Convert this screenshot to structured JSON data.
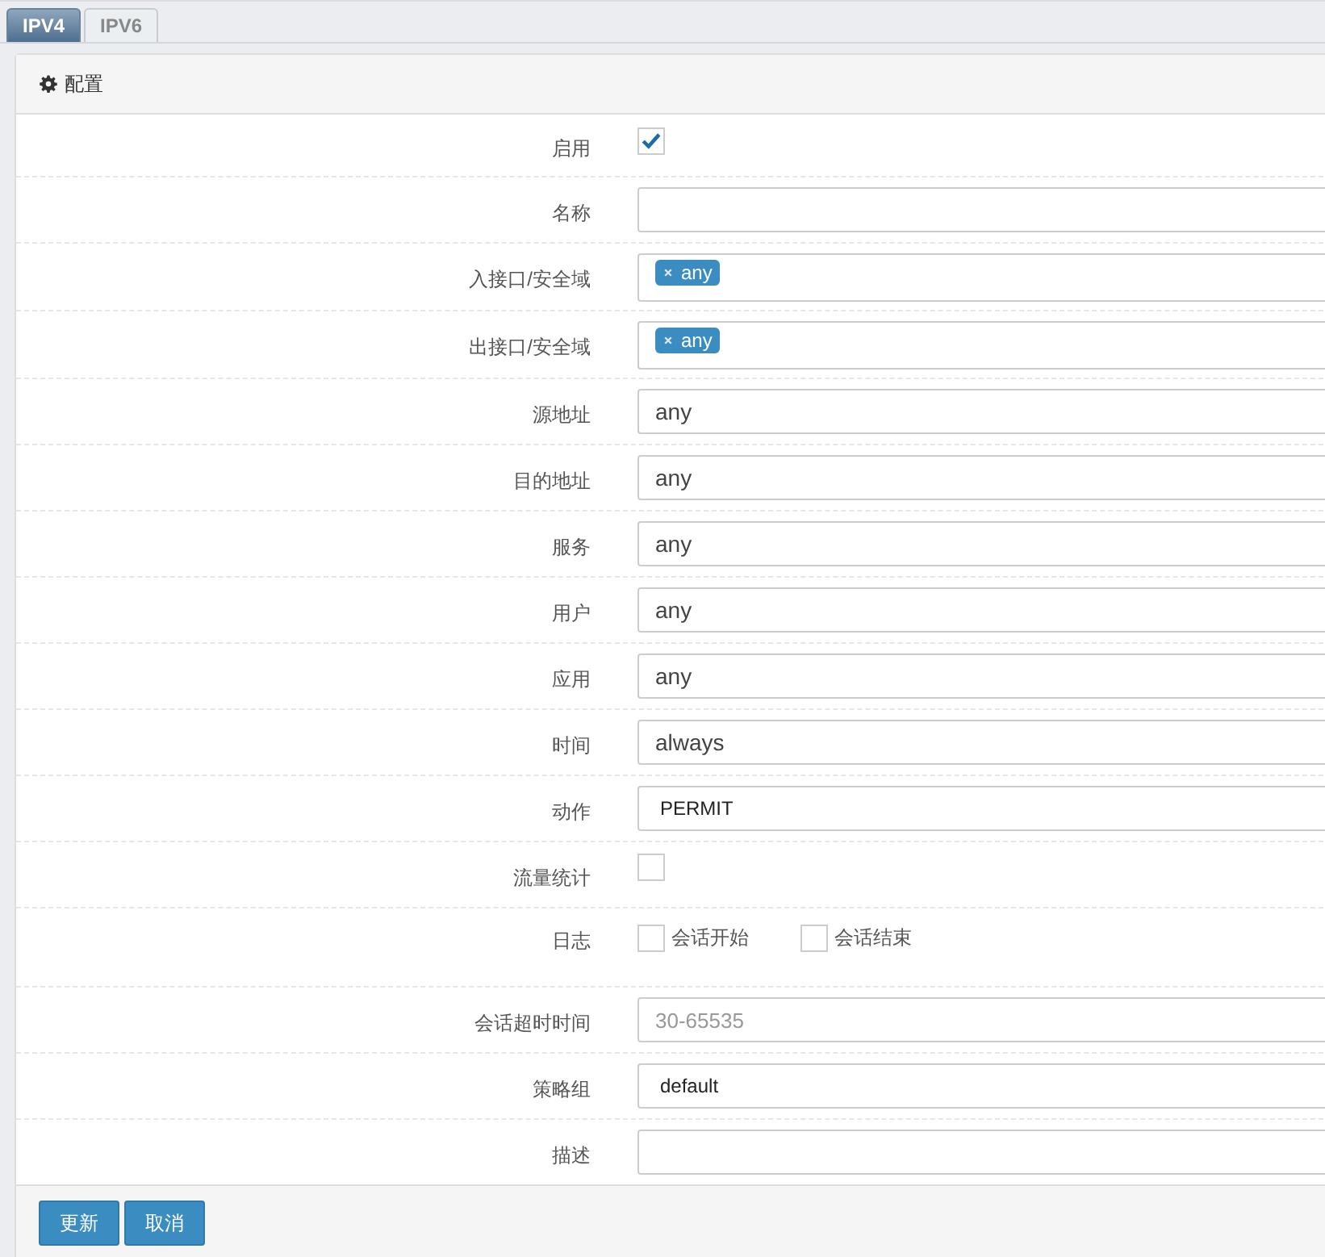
{
  "tabs": [
    {
      "label": "IPV4",
      "selected": true
    },
    {
      "label": "IPV6",
      "selected": false
    }
  ],
  "panel": {
    "title": "配置"
  },
  "fields": [
    {
      "kind": "checkbox",
      "label": "启用",
      "checked": true
    },
    {
      "kind": "text",
      "label": "名称"
    },
    {
      "kind": "tags",
      "label": "入接口/安全域",
      "tags": [
        "any"
      ]
    },
    {
      "kind": "tags",
      "label": "出接口/安全域",
      "tags": [
        "any"
      ]
    },
    {
      "kind": "text",
      "label": "源地址",
      "value": "any"
    },
    {
      "kind": "text",
      "label": "目的地址",
      "value": "any"
    },
    {
      "kind": "text",
      "label": "服务",
      "value": "any"
    },
    {
      "kind": "text",
      "label": "用户",
      "value": "any"
    },
    {
      "kind": "text",
      "label": "应用",
      "value": "any"
    },
    {
      "kind": "text",
      "label": "时间",
      "value": "always"
    },
    {
      "kind": "select",
      "label": "动作",
      "value": "PERMIT"
    },
    {
      "kind": "checkbox",
      "label": "流量统计",
      "checked": false
    },
    {
      "kind": "options",
      "label": "日志",
      "options": [
        {
          "label": "会话开始",
          "checked": false
        },
        {
          "label": "会话结束",
          "checked": false
        }
      ]
    },
    {
      "kind": "text",
      "label": "会话超时时间",
      "placeholder": "30-65535"
    },
    {
      "kind": "select",
      "label": "策略组",
      "value": "default"
    },
    {
      "kind": "text",
      "label": "描述"
    }
  ],
  "buttons": [
    "更新",
    "取消"
  ]
}
